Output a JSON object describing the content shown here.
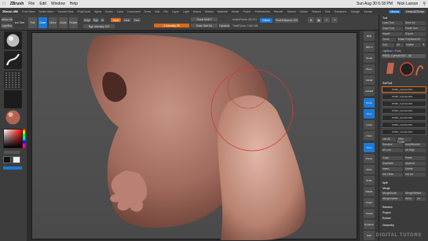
{
  "mac": {
    "apple": "",
    "app": "ZBrush",
    "menu": [
      "File",
      "Edit",
      "Window",
      "Help"
    ],
    "clock": "Sun Aug 30 6:18 PM",
    "user": "Nick Larson"
  },
  "appbar": {
    "title": "ZBrush 4R6",
    "stats": [
      "Free Mem",
      "Active Mem",
      "Scratch Disk",
      "Timer",
      "PolyCount",
      "Mesh Count"
    ],
    "menus": [
      "Alpha",
      "Brush",
      "Color",
      "Document",
      "Draw",
      "Edit",
      "File",
      "Layer",
      "Light",
      "Macro",
      "Marker",
      "Material",
      "Movie",
      "Picker",
      "Preferences",
      "Render",
      "Stencil",
      "Stroke",
      "Texture",
      "Tool",
      "Transform",
      "Zplugin",
      "Zscript"
    ],
    "menus_btn": "Menus",
    "defaultscript": "DefaultZScript"
  },
  "toolbar": {
    "left_btn": "Projection Master",
    "left_btn2": "LightBox",
    "edit": "Edit",
    "draw": "Draw",
    "move": "Move",
    "scale": "Scale",
    "rotate": "Rotate",
    "mrgb": "Mrgb",
    "rgb": "Rgb",
    "m": "M",
    "zadd": "Zadd",
    "zsub": "Zsub",
    "zcut": "Zcut",
    "rgb_int": "Rgb Intensity 100",
    "z_int": "Z Intensity 25",
    "focal": "Focal Shift 0",
    "draw_size": "Draw Size 64",
    "dynamic": "Dynamic",
    "active_points": "ActivePoints: 66,224",
    "total_points": "TotalPoints: 2.064 Mil",
    "pinch": "PinchDistance 100",
    "gizmo": "Gizmo",
    "quick": "Quick Sketch"
  },
  "right_shelf": [
    "BPR",
    "SPix 3",
    "Scroll",
    "Zoom",
    "Actual",
    "AAHalf",
    "Persp",
    "Floor",
    "Local",
    "LSym",
    "Gxyz",
    "Frame",
    "Move",
    "Scale",
    "Rotate",
    "PolyF",
    "Transp",
    "Dynamic",
    "Solo",
    "Xpose"
  ],
  "tray": {
    "title": "Tool",
    "load": "Load Tool",
    "save": "Save As",
    "copy": "Copy Tool",
    "paste": "Paste Tool",
    "import": "Import",
    "export": "Export",
    "clone": "Clone",
    "make_polymesh": "Make PolyMesh3D",
    "goz": "GoZ",
    "all": "All",
    "visible": "Visible",
    "r": "R",
    "lightbox_tools": "Lightbox › Tools",
    "tool_name": "PM3D_Cylinder3D1 . 48",
    "subtools": [
      "PM3D_Cylinder3D1",
      "PM3D_Cylinder3D1",
      "PM3D_Cylinder3D1",
      "PM3D_Cylinder3D1",
      "PM3D_Cylinder3D1",
      "PM3D_Cylinder3D1",
      "PM3D_Cylinder3D1"
    ],
    "subtool": "SubTool",
    "list_all": "List All",
    "new_folder": "New Folder",
    "rename": "Rename",
    "autoreorder": "AutoReorder",
    "all_low": "All Low",
    "all_high": "All High",
    "copy2": "Copy",
    "paste2": "Paste",
    "duplicate": "Duplicate",
    "append": "Append",
    "insert": "Insert",
    "delete": "Delete",
    "del_other": "Del Other",
    "del_all": "Del All",
    "split": "Split",
    "merge": "Merge",
    "merge_down": "MergeDown",
    "merge_similar": "MergeSimilar",
    "merge_visible": "MergeVisible",
    "weld": "Weld",
    "uv": "Uv",
    "remesh": "Remesh",
    "project": "Project",
    "extract": "Extract",
    "geometry": "Geometry"
  },
  "watermark": "DIGITAL TUTORS"
}
